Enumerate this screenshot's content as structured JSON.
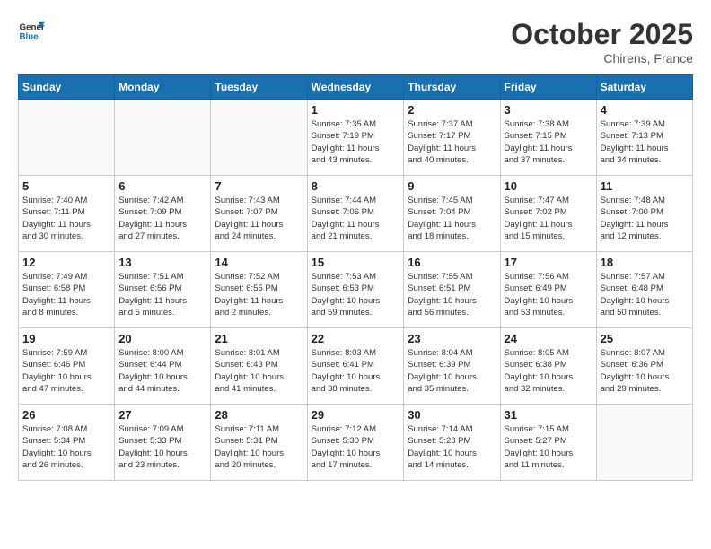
{
  "header": {
    "logo_general": "General",
    "logo_blue": "Blue",
    "month_title": "October 2025",
    "location": "Chirens, France"
  },
  "days_of_week": [
    "Sunday",
    "Monday",
    "Tuesday",
    "Wednesday",
    "Thursday",
    "Friday",
    "Saturday"
  ],
  "weeks": [
    [
      {
        "day": "",
        "info": ""
      },
      {
        "day": "",
        "info": ""
      },
      {
        "day": "",
        "info": ""
      },
      {
        "day": "1",
        "info": "Sunrise: 7:35 AM\nSunset: 7:19 PM\nDaylight: 11 hours\nand 43 minutes."
      },
      {
        "day": "2",
        "info": "Sunrise: 7:37 AM\nSunset: 7:17 PM\nDaylight: 11 hours\nand 40 minutes."
      },
      {
        "day": "3",
        "info": "Sunrise: 7:38 AM\nSunset: 7:15 PM\nDaylight: 11 hours\nand 37 minutes."
      },
      {
        "day": "4",
        "info": "Sunrise: 7:39 AM\nSunset: 7:13 PM\nDaylight: 11 hours\nand 34 minutes."
      }
    ],
    [
      {
        "day": "5",
        "info": "Sunrise: 7:40 AM\nSunset: 7:11 PM\nDaylight: 11 hours\nand 30 minutes."
      },
      {
        "day": "6",
        "info": "Sunrise: 7:42 AM\nSunset: 7:09 PM\nDaylight: 11 hours\nand 27 minutes."
      },
      {
        "day": "7",
        "info": "Sunrise: 7:43 AM\nSunset: 7:07 PM\nDaylight: 11 hours\nand 24 minutes."
      },
      {
        "day": "8",
        "info": "Sunrise: 7:44 AM\nSunset: 7:06 PM\nDaylight: 11 hours\nand 21 minutes."
      },
      {
        "day": "9",
        "info": "Sunrise: 7:45 AM\nSunset: 7:04 PM\nDaylight: 11 hours\nand 18 minutes."
      },
      {
        "day": "10",
        "info": "Sunrise: 7:47 AM\nSunset: 7:02 PM\nDaylight: 11 hours\nand 15 minutes."
      },
      {
        "day": "11",
        "info": "Sunrise: 7:48 AM\nSunset: 7:00 PM\nDaylight: 11 hours\nand 12 minutes."
      }
    ],
    [
      {
        "day": "12",
        "info": "Sunrise: 7:49 AM\nSunset: 6:58 PM\nDaylight: 11 hours\nand 8 minutes."
      },
      {
        "day": "13",
        "info": "Sunrise: 7:51 AM\nSunset: 6:56 PM\nDaylight: 11 hours\nand 5 minutes."
      },
      {
        "day": "14",
        "info": "Sunrise: 7:52 AM\nSunset: 6:55 PM\nDaylight: 11 hours\nand 2 minutes."
      },
      {
        "day": "15",
        "info": "Sunrise: 7:53 AM\nSunset: 6:53 PM\nDaylight: 10 hours\nand 59 minutes."
      },
      {
        "day": "16",
        "info": "Sunrise: 7:55 AM\nSunset: 6:51 PM\nDaylight: 10 hours\nand 56 minutes."
      },
      {
        "day": "17",
        "info": "Sunrise: 7:56 AM\nSunset: 6:49 PM\nDaylight: 10 hours\nand 53 minutes."
      },
      {
        "day": "18",
        "info": "Sunrise: 7:57 AM\nSunset: 6:48 PM\nDaylight: 10 hours\nand 50 minutes."
      }
    ],
    [
      {
        "day": "19",
        "info": "Sunrise: 7:59 AM\nSunset: 6:46 PM\nDaylight: 10 hours\nand 47 minutes."
      },
      {
        "day": "20",
        "info": "Sunrise: 8:00 AM\nSunset: 6:44 PM\nDaylight: 10 hours\nand 44 minutes."
      },
      {
        "day": "21",
        "info": "Sunrise: 8:01 AM\nSunset: 6:43 PM\nDaylight: 10 hours\nand 41 minutes."
      },
      {
        "day": "22",
        "info": "Sunrise: 8:03 AM\nSunset: 6:41 PM\nDaylight: 10 hours\nand 38 minutes."
      },
      {
        "day": "23",
        "info": "Sunrise: 8:04 AM\nSunset: 6:39 PM\nDaylight: 10 hours\nand 35 minutes."
      },
      {
        "day": "24",
        "info": "Sunrise: 8:05 AM\nSunset: 6:38 PM\nDaylight: 10 hours\nand 32 minutes."
      },
      {
        "day": "25",
        "info": "Sunrise: 8:07 AM\nSunset: 6:36 PM\nDaylight: 10 hours\nand 29 minutes."
      }
    ],
    [
      {
        "day": "26",
        "info": "Sunrise: 7:08 AM\nSunset: 5:34 PM\nDaylight: 10 hours\nand 26 minutes."
      },
      {
        "day": "27",
        "info": "Sunrise: 7:09 AM\nSunset: 5:33 PM\nDaylight: 10 hours\nand 23 minutes."
      },
      {
        "day": "28",
        "info": "Sunrise: 7:11 AM\nSunset: 5:31 PM\nDaylight: 10 hours\nand 20 minutes."
      },
      {
        "day": "29",
        "info": "Sunrise: 7:12 AM\nSunset: 5:30 PM\nDaylight: 10 hours\nand 17 minutes."
      },
      {
        "day": "30",
        "info": "Sunrise: 7:14 AM\nSunset: 5:28 PM\nDaylight: 10 hours\nand 14 minutes."
      },
      {
        "day": "31",
        "info": "Sunrise: 7:15 AM\nSunset: 5:27 PM\nDaylight: 10 hours\nand 11 minutes."
      },
      {
        "day": "",
        "info": ""
      }
    ]
  ]
}
